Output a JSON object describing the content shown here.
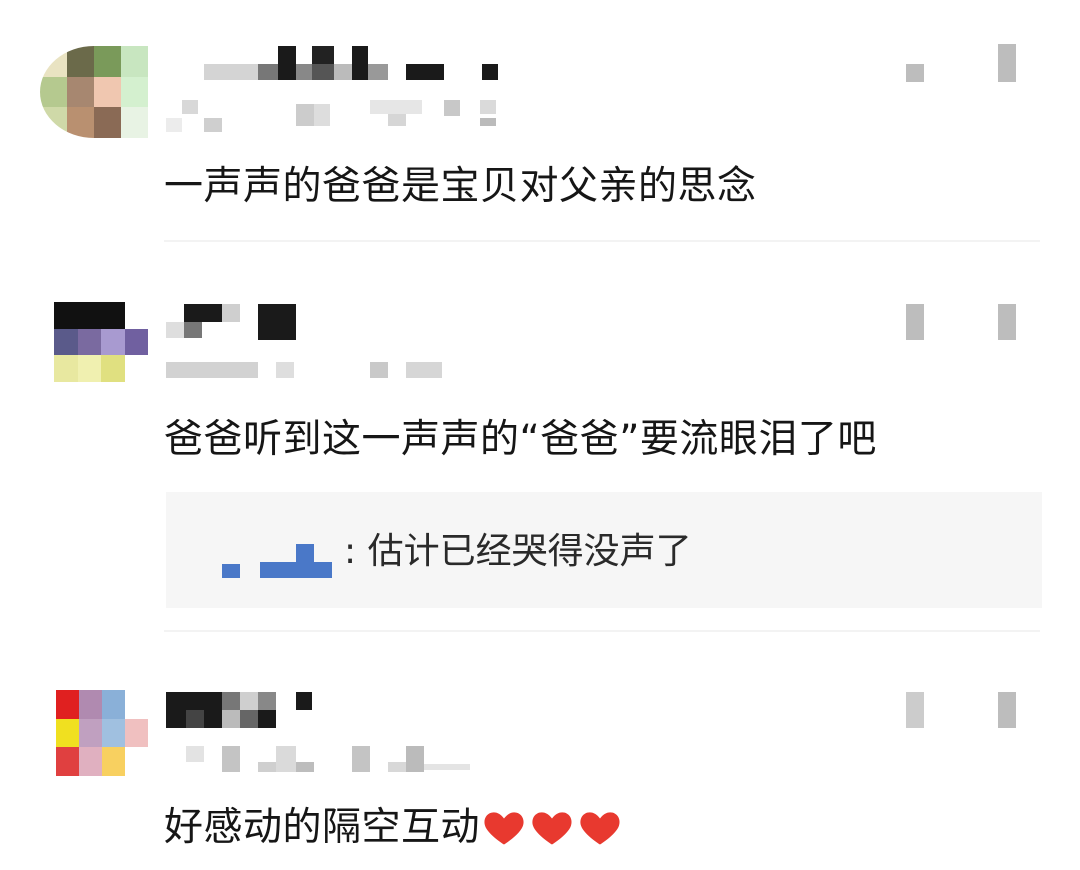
{
  "comments": [
    {
      "text": "一声声的爸爸是宝贝对父亲的思念",
      "avatar_colors": [
        "#e9e3c2",
        "#6b6a4a",
        "#7a9a5a",
        "#c8e6c0",
        "#b5c98f",
        "#a78770",
        "#f0c7b0",
        "#d4f0cf",
        "#cfd9a8",
        "#b99070",
        "#8a6a55",
        "#e8f3e4"
      ]
    },
    {
      "text": "爸爸听到这一声声的“爸爸”要流眼泪了吧",
      "avatar_colors": [
        "#111111",
        "#111111",
        "#111111",
        "#ffffff",
        "#5a5a8a",
        "#7a6aa0",
        "#a89ad0",
        "#7060a0",
        "#e8e8a0",
        "#f0f0b0",
        "#e0e080",
        "#ffffff"
      ],
      "reply": {
        "text": ": 估计已经哭得没声了"
      }
    },
    {
      "text": "好感动的隔空互动",
      "emoji": [
        "heart-icon",
        "heart-icon",
        "heart-icon"
      ],
      "avatar_colors": [
        "#e02020",
        "#b08ab0",
        "#8ab0d8",
        "#ffffff",
        "#f0e020",
        "#c0a0c0",
        "#a0c0e0",
        "#f0c0c0",
        "#e04040",
        "#e0b0c0",
        "#f8d060",
        "#ffffff"
      ]
    }
  ],
  "colors": {
    "heart": "#e8392f",
    "reply_name": "#4a78c8"
  }
}
